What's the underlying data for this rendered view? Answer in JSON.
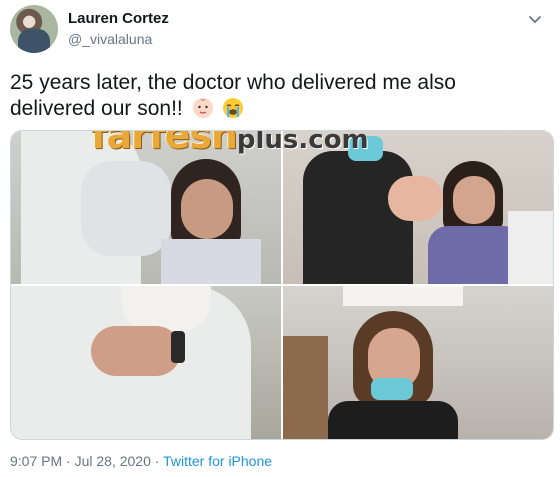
{
  "user": {
    "name": "Lauren Cortez",
    "handle": "@_vivalaluna"
  },
  "tweet": {
    "line1": "25 years later, the doctor who delivered me also",
    "line2": "delivered our son!!",
    "emojis": [
      "baby-face-icon",
      "loudly-crying-face-icon"
    ]
  },
  "media": {
    "watermark_main": "farfesh",
    "watermark_plus": "plus.com"
  },
  "meta": {
    "time": "9:07 PM",
    "sep1": " · ",
    "date": "Jul 28, 2020",
    "sep2": " · ",
    "source": "Twitter for iPhone"
  },
  "colors": {
    "link": "#1b95e0",
    "muted": "#657786",
    "text": "#14171a",
    "watermark": "#e8a93a"
  }
}
